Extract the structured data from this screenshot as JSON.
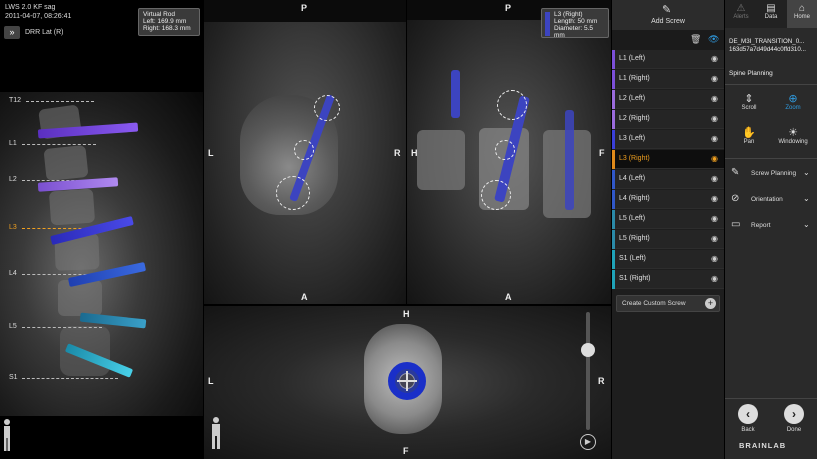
{
  "left_panel": {
    "study": "LWS 2.0 KF sag",
    "datetime": "2011-04-07, 08:26:41",
    "view_mode": "DRR Lat (R)",
    "rod_box": {
      "title": "Virtual Rod",
      "left": "Left: 169.9 mm",
      "right": "Right: 168.3 mm"
    },
    "levels": [
      "T12",
      "L1",
      "L2",
      "L3",
      "L4",
      "L5",
      "S1"
    ],
    "active_level": "L3"
  },
  "views": {
    "axial": {
      "top": "P",
      "left": "L",
      "right": "R",
      "bottom": "A"
    },
    "sagittal": {
      "top": "P",
      "left": "H",
      "right": "F",
      "bottom": "A"
    },
    "screw_info": {
      "name": "L3 (Right)",
      "length": "Length: 50 mm",
      "diameter": "Diameter: 5.5 mm"
    },
    "coronal": {
      "top": "H",
      "left": "L",
      "right": "R",
      "bottom": "F"
    }
  },
  "screw_list": {
    "add_label": "Add Screw",
    "items": [
      {
        "label": "L1 (Left)",
        "color": "#7b4fd8"
      },
      {
        "label": "L1 (Right)",
        "color": "#7b4fd8"
      },
      {
        "label": "L2 (Left)",
        "color": "#9a6bdc"
      },
      {
        "label": "L2 (Right)",
        "color": "#9a6bdc"
      },
      {
        "label": "L3 (Left)",
        "color": "#3a3fd8"
      },
      {
        "label": "L3 (Right)",
        "color": "#e08a1a"
      },
      {
        "label": "L4 (Left)",
        "color": "#3057c8"
      },
      {
        "label": "L4 (Right)",
        "color": "#3057c8"
      },
      {
        "label": "L5 (Left)",
        "color": "#2a8aa8"
      },
      {
        "label": "L5 (Right)",
        "color": "#2a8aa8"
      },
      {
        "label": "S1 (Left)",
        "color": "#1fa3b8"
      },
      {
        "label": "S1 (Right)",
        "color": "#1fa3b8"
      }
    ],
    "selected_index": 5,
    "create_custom": "Create Custom Screw"
  },
  "tools": {
    "nav": {
      "alerts": "Alerts",
      "data": "Data",
      "home": "Home"
    },
    "patient_id": "DE_M3I_TRANSITION_0...",
    "patient_uid": "163d57a7d49d44c0ffd310...",
    "section": "Spine Planning",
    "buttons": {
      "scroll": "Scroll",
      "zoom": "Zoom",
      "pan": "Pan",
      "windowing": "Windowing"
    },
    "menus": {
      "screw_planning": "Screw Planning",
      "orientation": "Orientation",
      "report": "Report"
    },
    "back": "Back",
    "done": "Done",
    "brand": "BRAINLAB"
  }
}
